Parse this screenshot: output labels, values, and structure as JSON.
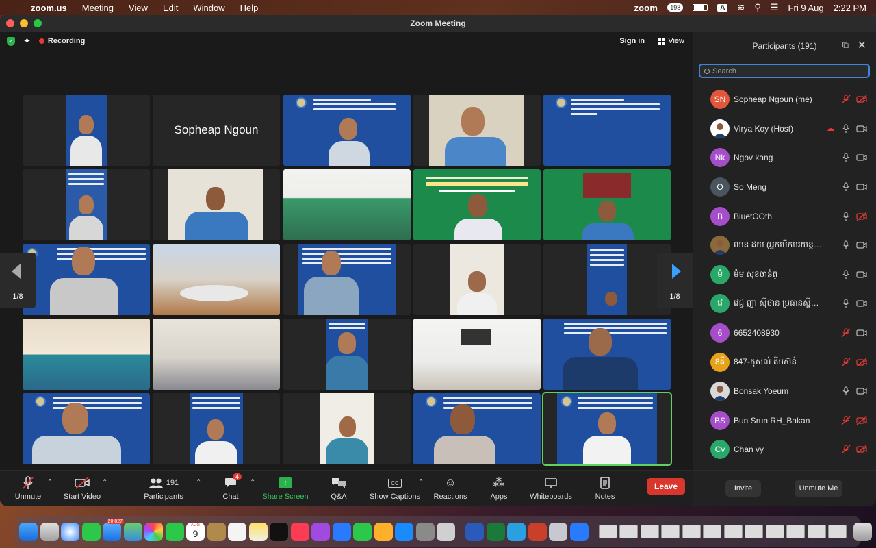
{
  "menubar": {
    "app": "zoom.us",
    "menus": [
      "Meeting",
      "View",
      "Edit",
      "Window",
      "Help"
    ],
    "zoom_word": "zoom",
    "zoom_badge": "198",
    "input_source": "A",
    "date": "Fri 9 Aug",
    "time": "2:22 PM"
  },
  "window": {
    "title": "Zoom Meeting"
  },
  "meeting": {
    "recording_label": "Recording",
    "sign_in": "Sign in",
    "view": "View",
    "page_left": "1/8",
    "page_right": "1/8"
  },
  "tiles": {
    "name_only": "Sopheap Ngoun"
  },
  "toolbar": {
    "unmute": "Unmute",
    "start_video": "Start Video",
    "participants": "Participants",
    "participants_count": "191",
    "chat": "Chat",
    "chat_badge": "4",
    "share_screen": "Share Screen",
    "qa": "Q&A",
    "show_captions": "Show Captions",
    "cc": "CC",
    "reactions": "Reactions",
    "apps": "Apps",
    "whiteboards": "Whiteboards",
    "notes": "Notes",
    "leave": "Leave"
  },
  "panel": {
    "title": "Participants (191)",
    "search_placeholder": "Search",
    "invite": "Invite",
    "unmute_me": "Unmute Me",
    "participants": [
      {
        "initials": "SN",
        "name": "Sopheap Ngoun (me)",
        "color": "#e0573c",
        "mic_muted": true,
        "cam_off": true
      },
      {
        "initials": "",
        "name": "Virya Koy (Host)",
        "color": "#ffffff",
        "mic_muted": false,
        "cam_off": false,
        "cloud": true
      },
      {
        "initials": "Nk",
        "name": "Ngov kang",
        "color": "#a64ec9",
        "mic_muted": false,
        "cam_off": false
      },
      {
        "initials": "O",
        "name": "So Meng",
        "color": "#4a5560",
        "mic_muted": false,
        "cam_off": false
      },
      {
        "initials": "B",
        "name": "BluetOOth",
        "color": "#a64ec9",
        "mic_muted": false,
        "cam_off": true
      },
      {
        "initials": "",
        "name": "ឈន ដយ (អ្នកបើកបរយន្តបន្ទី...",
        "color": "#8a6a3a",
        "mic_muted": false,
        "cam_off": false
      },
      {
        "initials": "មំ",
        "name": "មំម សុខចាន់ត្",
        "color": "#2aa86a",
        "mic_muted": false,
        "cam_off": false
      },
      {
        "initials": "វេ",
        "name": "វេជ្ជ ញា សុីថាន ប្រធានស្ទីទីមន្ទី...",
        "color": "#2aa86a",
        "mic_muted": false,
        "cam_off": false
      },
      {
        "initials": "6",
        "name": "6652408930",
        "color": "#a64ec9",
        "mic_muted": true,
        "cam_off": false
      },
      {
        "initials": "8គី",
        "name": "847-កុសល់ គីមស៊ន់",
        "color": "#e8a21a",
        "mic_muted": true,
        "cam_off": true
      },
      {
        "initials": "",
        "name": "Bonsak Yoeum",
        "color": "#d8d8d8",
        "mic_muted": false,
        "cam_off": false
      },
      {
        "initials": "BS",
        "name": "Bun Srun RH_Bakan",
        "color": "#a64ec9",
        "mic_muted": true,
        "cam_off": true
      },
      {
        "initials": "Cv",
        "name": "Chan vy",
        "color": "#2aa86a",
        "mic_muted": true,
        "cam_off": true
      }
    ]
  },
  "dock": {
    "mail_badge": "20,827",
    "calendar_month": "AUG",
    "calendar_day": "9"
  }
}
